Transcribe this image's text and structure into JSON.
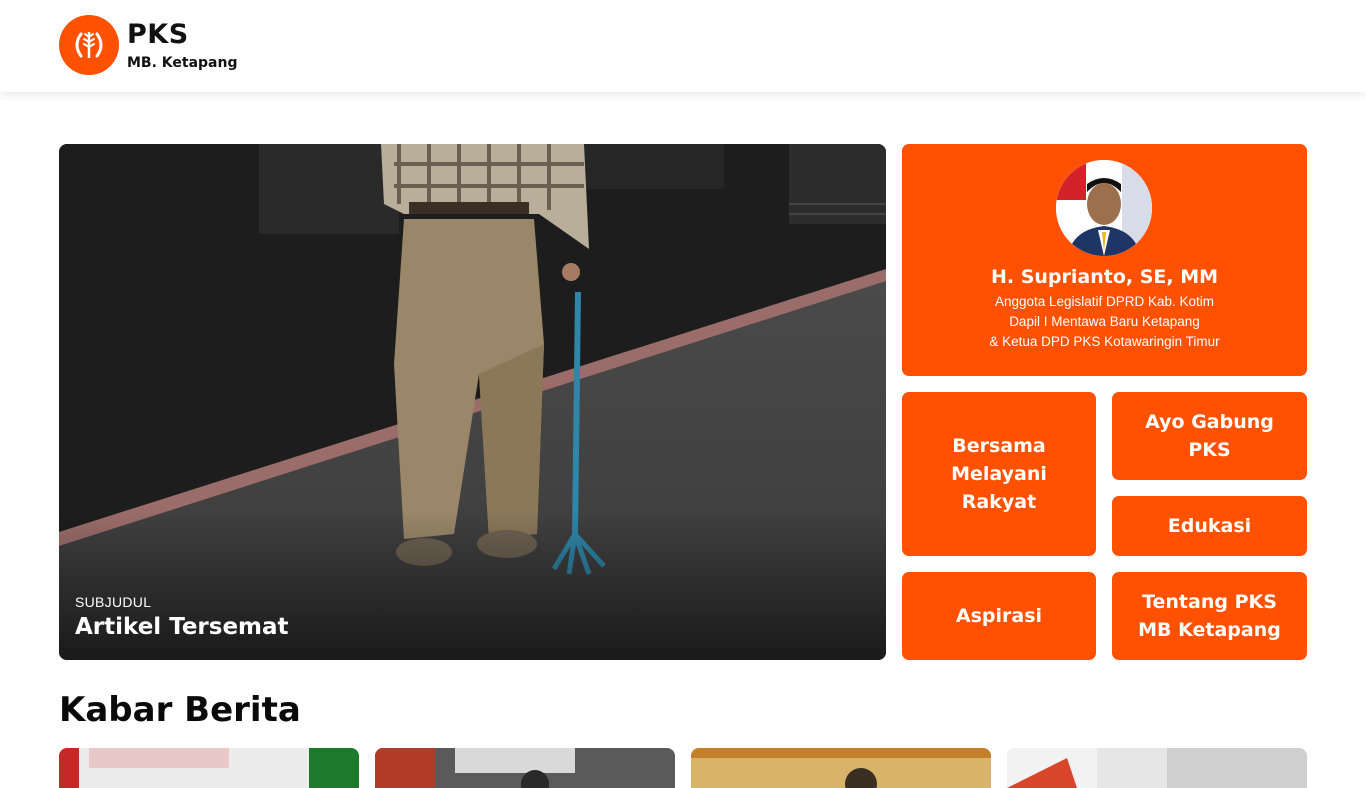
{
  "brand": {
    "name": "PKS",
    "subtitle": "MB. Ketapang",
    "accent": "#ff5100",
    "logo_icon": "pks-logo-icon"
  },
  "hero": {
    "subtitle": "SUBJUDUL",
    "title": "Artikel Tersemat",
    "image": "elderly-man-walking-with-cane"
  },
  "profile": {
    "name": "H. Suprianto, SE, MM",
    "lines": [
      "Anggota Legislatif DPRD Kab. Kotim",
      "Dapil I Mentawa Baru Ketapang",
      "& Ketua DPD PKS Kotawaringin Timur"
    ],
    "avatar": "portrait-photo"
  },
  "tiles": {
    "bersama": "Bersama Melayani Rakyat",
    "gabung": "Ayo Gabung PKS",
    "edukasi": "Edukasi",
    "aspirasi": "Aspirasi",
    "tentang": "Tentang PKS MB Ketapang"
  },
  "news": {
    "heading": "Kabar Berita"
  }
}
